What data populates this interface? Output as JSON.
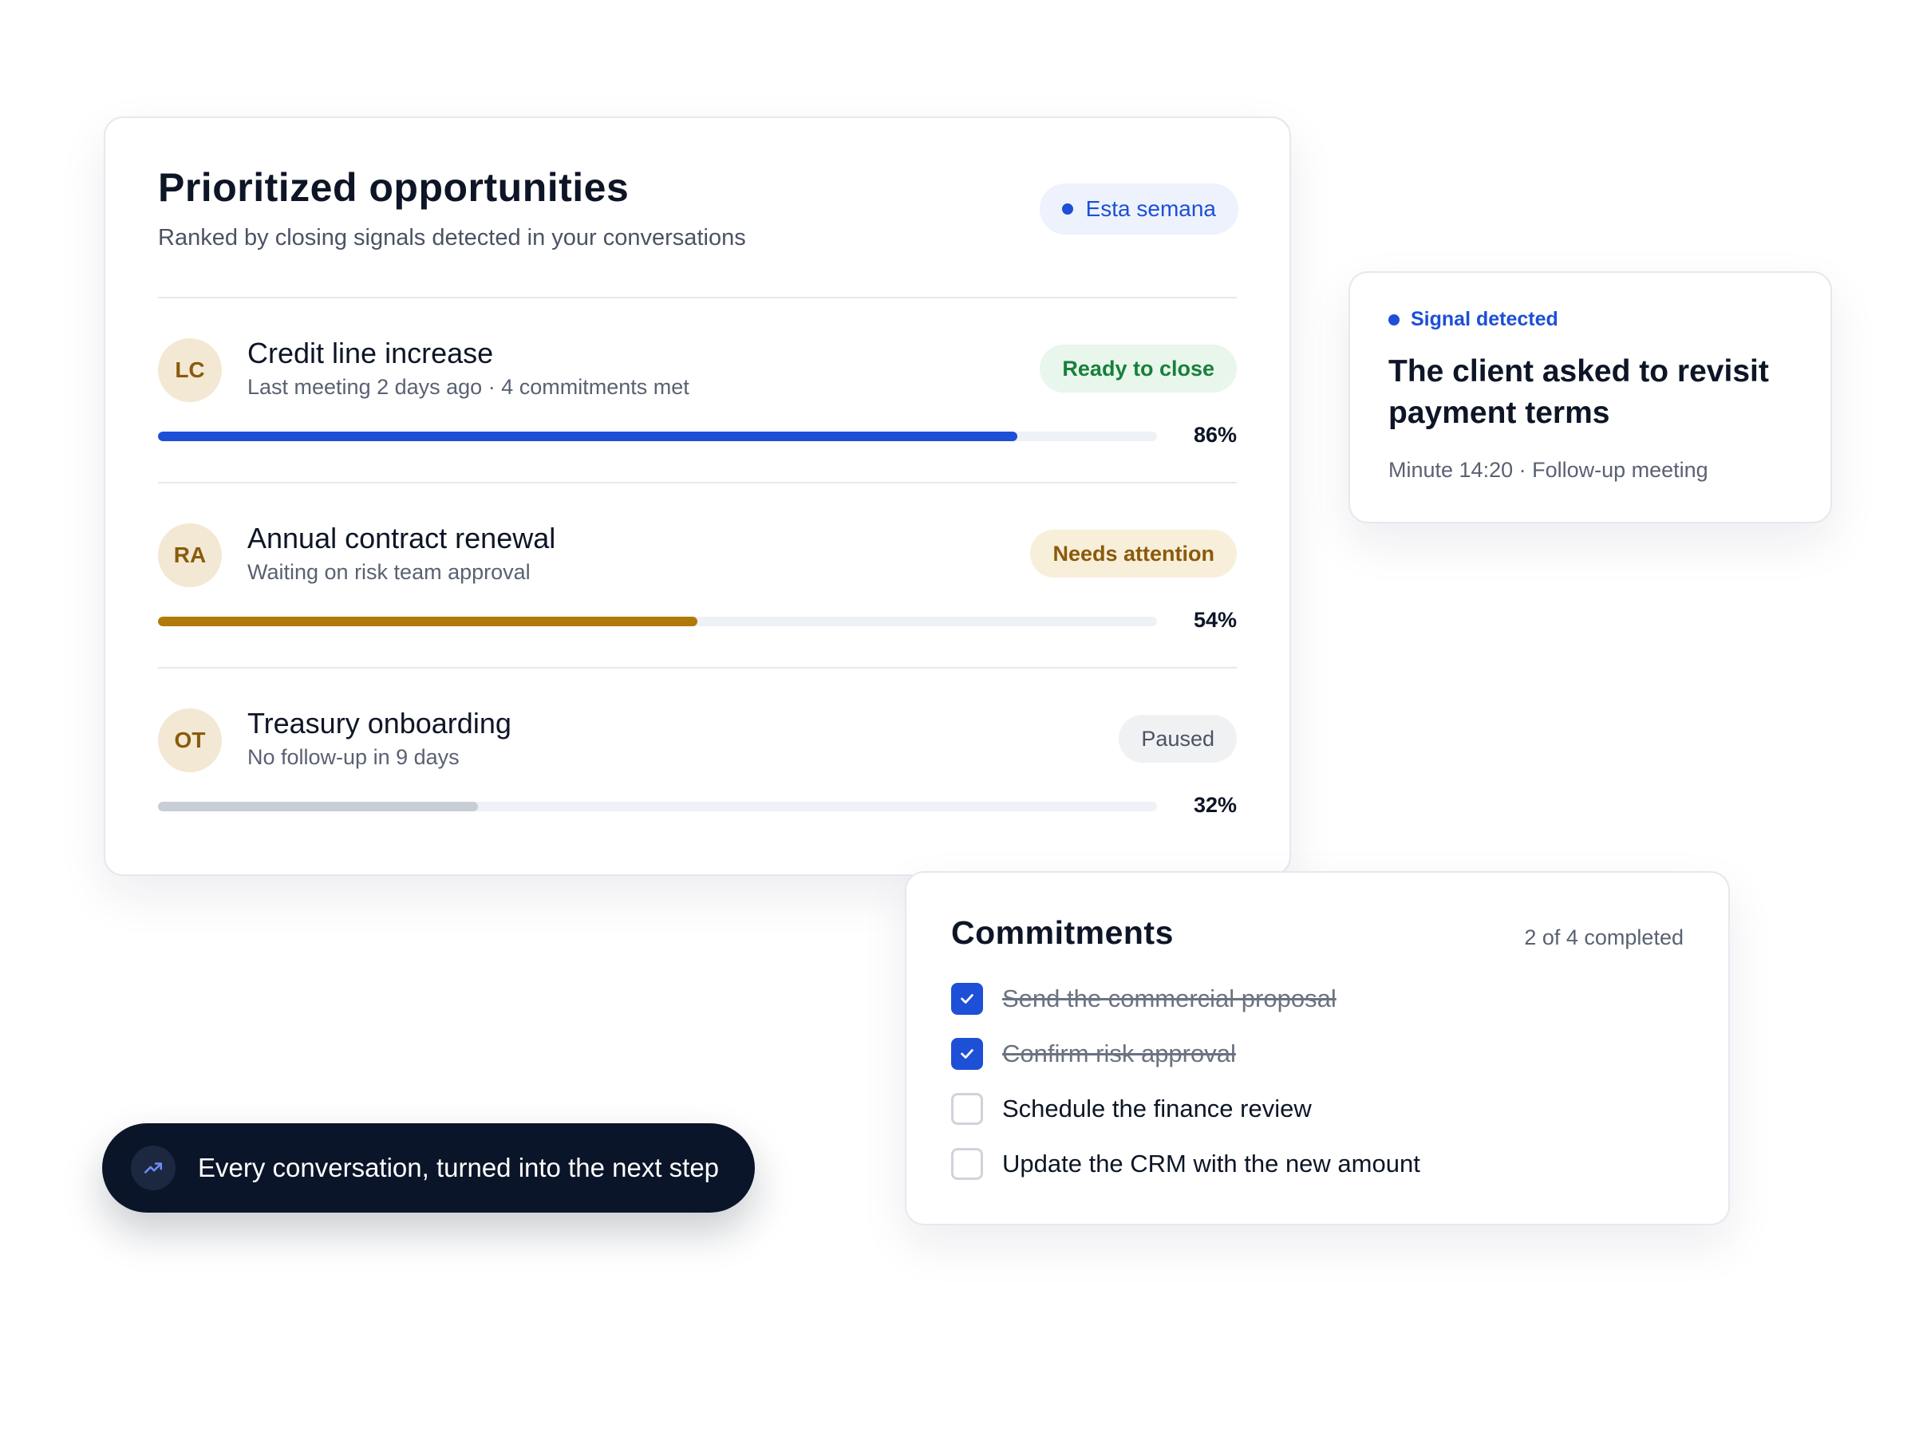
{
  "opportunities": {
    "title": "Prioritized opportunities",
    "subtitle": "Ranked by closing signals detected in your conversations",
    "period_label": "Esta semana",
    "items": [
      {
        "initials": "LC",
        "title": "Credit line increase",
        "meta": "Last meeting 2 days ago · 4 commitments met",
        "status": "Ready to close",
        "progress": 86,
        "progress_label": "86%",
        "bar_color": "#1d4fd7"
      },
      {
        "initials": "RA",
        "title": "Annual contract renewal",
        "meta": "Waiting on risk team approval",
        "status": "Needs attention",
        "progress": 54,
        "progress_label": "54%",
        "bar_color": "#b07a08"
      },
      {
        "initials": "OT",
        "title": "Treasury onboarding",
        "meta": "No follow-up in 9 days",
        "status": "Paused",
        "progress": 32,
        "progress_label": "32%",
        "bar_color": "#c9cdd5"
      }
    ]
  },
  "signal": {
    "label": "Signal detected",
    "title": "The client asked to revisit payment terms",
    "meta": "Minute 14:20 · Follow-up meeting"
  },
  "commitments": {
    "title": "Commitments",
    "count_label": "2 of 4 completed",
    "items": [
      {
        "text": "Send the commercial proposal",
        "done": true
      },
      {
        "text": "Confirm risk approval",
        "done": true
      },
      {
        "text": "Schedule the finance review",
        "done": false
      },
      {
        "text": "Update the CRM with the new amount",
        "done": false
      }
    ]
  },
  "banner": {
    "text": "Every conversation, turned into the next step",
    "icon": "trending-up-icon"
  },
  "colors": {
    "accent": "#1d4fd7",
    "amber": "#b07a08",
    "muted": "#c9cdd5",
    "dark": "#0b1529"
  }
}
